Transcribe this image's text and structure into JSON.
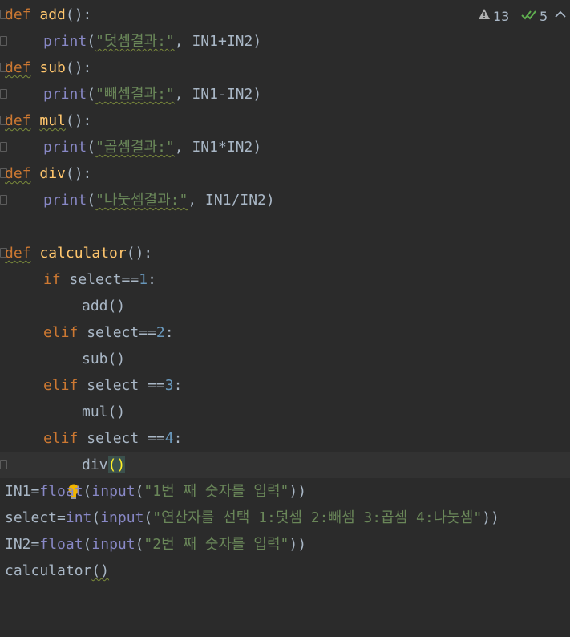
{
  "inspections": {
    "warnings_count": "13",
    "checks_count": "5"
  },
  "code": {
    "def_kw": "def",
    "add_name": "add",
    "sub_name": "sub",
    "mul_name": "mul",
    "div_name": "div",
    "calc_name": "calculator",
    "sig_tail": "():",
    "print_fn": "print",
    "open_paren": "(",
    "close_paren": ")",
    "str_add": "\"덧셈결과:\"",
    "str_sub": "\"빼셈결과:\"",
    "str_mul": "\"곱셈결과:\"",
    "str_div": "\"나눗셈결과:\"",
    "args_add": ", IN1+IN2)",
    "args_sub": ", IN1-IN2)",
    "args_mul": ", IN1*IN2)",
    "args_div": ", IN1/IN2)",
    "if_kw": "if",
    "elif_kw": "elif",
    "sel_eq": " select==",
    "sel_sp_eq": " select ==",
    "n1": "1",
    "n2": "2",
    "n3": "3",
    "n4": "4",
    "colon": ":",
    "call_add": "add()",
    "call_sub": "sub()",
    "call_mul": "mul()",
    "call_div_name": "div",
    "call_div_parens": "()",
    "in1_assign": "IN1=",
    "select_assign": "select=",
    "in2_assign": "IN2=",
    "float_fn": "float",
    "int_fn": "int",
    "input_fn": "input",
    "str_in1": "\"1번 째 숫자를 입력\"",
    "str_select": "\"연산자를 선택 1:덧셈 2:빼셈 3:곱셈 4:나눗셈\"",
    "str_in2": "\"2번 째 숫자를 입력\"",
    "close_two": "))",
    "calc_call": "calculator",
    "empty_parens": "()"
  }
}
